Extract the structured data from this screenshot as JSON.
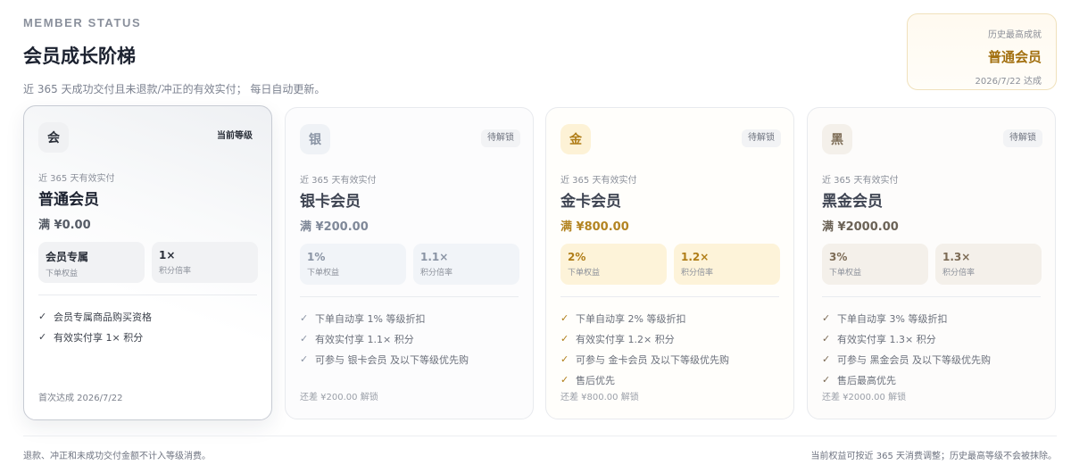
{
  "header": {
    "eyebrow": "MEMBER STATUS",
    "title": "会员成长阶梯",
    "subtitle": "近 365 天成功交付且未退款/冲正的有效实付； 每日自动更新。"
  },
  "best": {
    "label": "历史最高成就",
    "tier": "普通会员",
    "date": "2026/7/22 达成"
  },
  "cards": [
    {
      "icon_char": "会",
      "status": "当前等级",
      "caption": "近 365 天有效实付",
      "name": "普通会员",
      "threshold": "满 ¥0.00",
      "stat1_value": "会员专属",
      "stat1_label": "下单权益",
      "stat2_value": "1×",
      "stat2_label": "积分倍率",
      "perks": [
        "会员专属商品购买资格",
        "有效实付享 1× 积分"
      ],
      "footer": "首次达成 2026/7/22"
    },
    {
      "icon_char": "银",
      "status": "待解锁",
      "caption": "近 365 天有效实付",
      "name": "银卡会员",
      "threshold": "满 ¥200.00",
      "stat1_value": "1%",
      "stat1_label": "下单权益",
      "stat2_value": "1.1×",
      "stat2_label": "积分倍率",
      "perks": [
        "下单自动享 1% 等级折扣",
        "有效实付享 1.1× 积分",
        "可参与 银卡会员 及以下等级优先购"
      ],
      "footer": "还差 ¥200.00 解锁"
    },
    {
      "icon_char": "金",
      "status": "待解锁",
      "caption": "近 365 天有效实付",
      "name": "金卡会员",
      "threshold": "满 ¥800.00",
      "stat1_value": "2%",
      "stat1_label": "下单权益",
      "stat2_value": "1.2×",
      "stat2_label": "积分倍率",
      "perks": [
        "下单自动享 2% 等级折扣",
        "有效实付享 1.2× 积分",
        "可参与 金卡会员 及以下等级优先购",
        "售后优先"
      ],
      "footer": "还差 ¥800.00 解锁"
    },
    {
      "icon_char": "黑",
      "status": "待解锁",
      "caption": "近 365 天有效实付",
      "name": "黑金会员",
      "threshold": "满 ¥2000.00",
      "stat1_value": "3%",
      "stat1_label": "下单权益",
      "stat2_value": "1.3×",
      "stat2_label": "积分倍率",
      "perks": [
        "下单自动享 3% 等级折扣",
        "有效实付享 1.3× 积分",
        "可参与 黑金会员 及以下等级优先购",
        "售后最高优先"
      ],
      "footer": "还差 ¥2000.00 解锁"
    }
  ],
  "footer": {
    "left": "退款、冲正和未成功交付金额不计入等级消费。",
    "right": "当前权益可按近 365 天消费调整；历史最高等级不会被抹除。"
  },
  "icons": {
    "perk_check": "check-icon"
  },
  "colors": {
    "gold_accent": "#b07d17",
    "silver_accent": "#8a94a4",
    "black_accent": "#7c6b55"
  }
}
